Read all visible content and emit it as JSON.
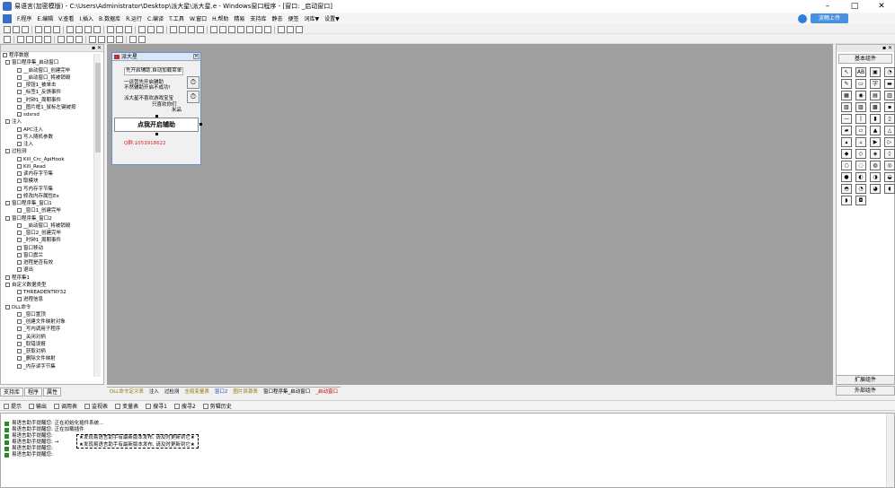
{
  "window": {
    "title": "易语言(加密模版) - C:\\Users\\Administrator\\Desktop\\派大星\\派大星.e - Windows窗口程序 - [窗口: _启动窗口]",
    "min": "–",
    "max": "□",
    "close": "✕"
  },
  "menu": [
    "F.程序",
    "E.编辑",
    "V.查看",
    "I.插入",
    "B.数据库",
    "R.运行",
    "C.编译",
    "T.工具",
    "W.窗口",
    "H.帮助",
    "精易",
    "支持库",
    "静态",
    "便签",
    "词库▼",
    "设置▼"
  ],
  "cloud": {
    "label": "流畅上传"
  },
  "left_panel": {
    "tree": [
      "程序数据",
      "窗口程序集_启动窗口",
      "__启动窗口_创建完毕",
      "__启动窗口_将被销毁",
      "_按钮1_被单击",
      "_标签1_反馈事件",
      "_时钟1_周期事件",
      "_图片框1_鼠标左键被按",
      "sdsrsd",
      "注入",
      "APC注入",
      "写入随机参数",
      "注入",
      "过检测",
      "Kill_Crc_ApiHook",
      "Kill_Read",
      "读内存字节集",
      "取模块",
      "写内存字节集",
      "修改内存属性Ex",
      "窗口程序集_窗口1",
      "_窗口1_创建完毕",
      "窗口程序集_窗口2",
      "__启动窗口_将被销毁",
      "_窗口2_创建完毕",
      "_时钟1_周期事件",
      "窗口移动",
      "窗口震兰",
      "进程是否有效",
      "退出",
      "程序集1",
      "自定义数据类型",
      "THREADENTRY32",
      "进程信息",
      "DLL命令",
      "_窗口置顶",
      "_创建文件映射对象",
      "_写内调用子程序",
      "_关闭对柄",
      "_取错误报",
      "_获取对柄",
      "_删除文件映射",
      "_内存读字节集"
    ],
    "tabs": [
      "支持库",
      "程序",
      "属性"
    ]
  },
  "form": {
    "title": "派大星",
    "line1": "先开启辅助,自动加载菜单",
    "line2": "一运营先开启辅助",
    "line3": "不然辅助开启不成功!",
    "line4": "派大星不喜欢游戏宝宝",
    "line5": "只喜欢你们",
    "line6": "米品",
    "button": "点我开启辅助",
    "qq": "Q群:1053918622"
  },
  "right_panel": {
    "title": "基本组件",
    "components": [
      "↖",
      "AB",
      "▣",
      "◔",
      "✎",
      "▭",
      "字",
      "▬",
      "▦",
      "◉",
      "▤",
      "▥",
      "▧",
      "▨",
      "▩",
      "▪",
      "—",
      "|",
      "▮",
      "▯",
      "▰",
      "▱",
      "▲",
      "△",
      "▴",
      "▵",
      "▶",
      "▷",
      "◆",
      "◇",
      "◈",
      "◊",
      "○",
      "◌",
      "◍",
      "◎",
      "●",
      "◐",
      "◑",
      "◒",
      "◓",
      "◔",
      "◕",
      "◖",
      "◗",
      "◘"
    ],
    "bottom": [
      "扩展组件",
      "外部组件"
    ]
  },
  "doc_tabs": [
    "DLL命令定义表",
    "注入",
    "过检测",
    "全局变量表",
    "窗口2",
    "图片资源表",
    "窗口程序集_启动窗口",
    "_启动窗口"
  ],
  "output_tabs": [
    "提示",
    "输出",
    "调用表",
    "监视表",
    "变量表",
    "搜寻1",
    "搜寻2",
    "剪辑历史"
  ],
  "output_lines": [
    "易语言助手提醒您:  正在初始化插件系统...",
    "易语言助手提醒您:  正在加载插件",
    "易语言助手提醒您:",
    "易语言助手提醒您:  →",
    "易语言助手提醒您:",
    "易语言助手提醒您:"
  ],
  "output_box": [
    "★发现易语言助手有最新版本发布, 请及时更新到它★",
    "★发现易语言助手有最新版本发布, 请及时更新到它★"
  ]
}
